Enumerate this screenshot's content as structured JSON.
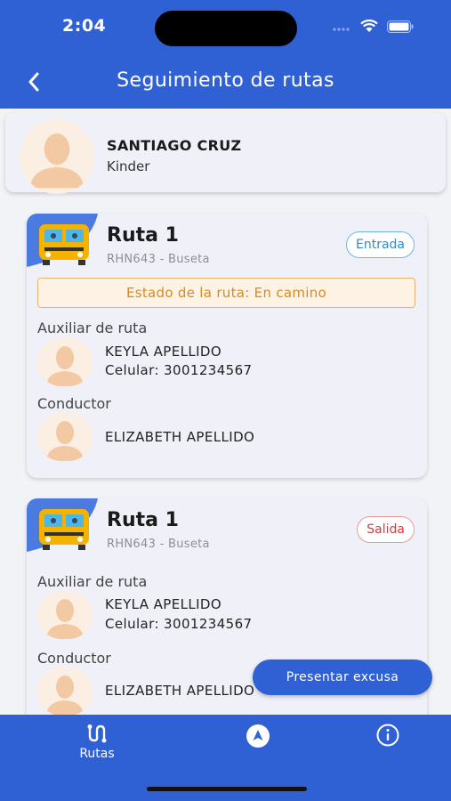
{
  "status_bar": {
    "time": "2:04"
  },
  "header": {
    "title": "Seguimiento de rutas"
  },
  "student": {
    "name": "SANTIAGO CRUZ",
    "grade": "Kinder"
  },
  "routes": [
    {
      "name": "Ruta 1",
      "plate": "RHN643 - Buseta",
      "badge": "Entrada",
      "status": "Estado de la ruta: En camino",
      "assistant_label": "Auxiliar de ruta",
      "assistant_name": "KEYLA APELLIDO",
      "assistant_phone": "Celular: 3001234567",
      "driver_label": "Conductor",
      "driver_name": "ELIZABETH  APELLIDO"
    },
    {
      "name": "Ruta 1",
      "plate": "RHN643 - Buseta",
      "badge": "Salida",
      "assistant_label": "Auxiliar de ruta",
      "assistant_name": "KEYLA APELLIDO",
      "assistant_phone": "Celular: 3001234567",
      "driver_label": "Conductor",
      "driver_name": "ELIZABETH  APELLIDO"
    }
  ],
  "fab": {
    "label": "Presentar excusa"
  },
  "tabs": [
    {
      "label": "Rutas",
      "icon": "route-icon"
    },
    {
      "label": "",
      "icon": "navigation-icon"
    },
    {
      "label": "",
      "icon": "info-icon"
    }
  ],
  "colors": {
    "primary": "#2f61d5",
    "entrada": "#2e8bcf",
    "salida": "#d53a3a",
    "status": "#d98a1f"
  }
}
